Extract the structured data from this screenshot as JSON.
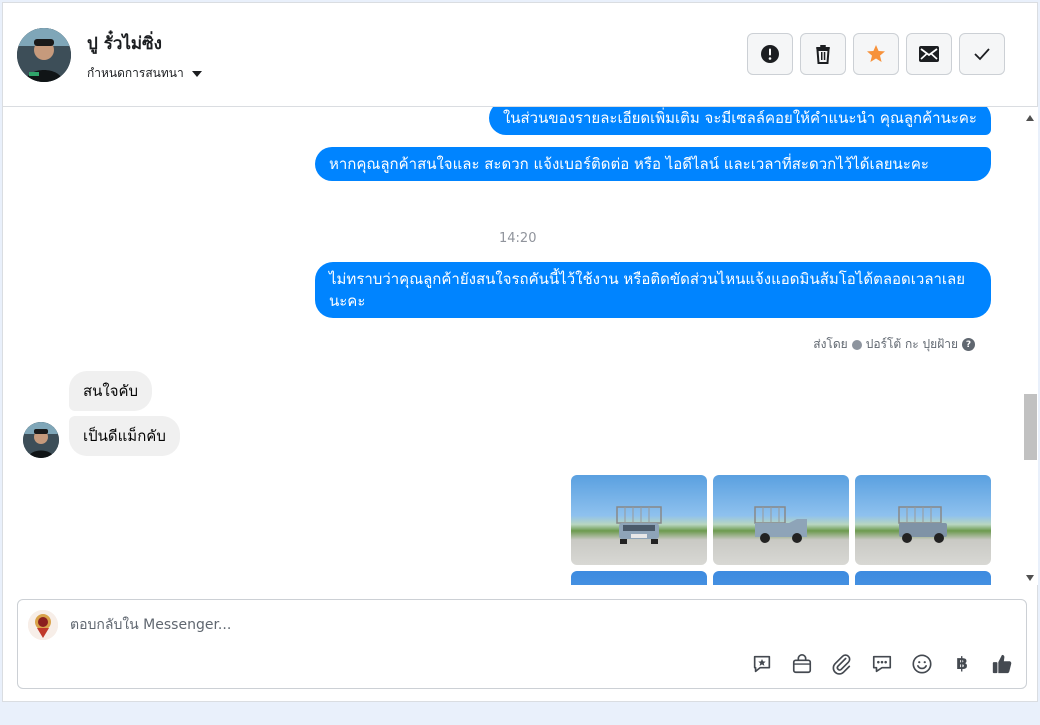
{
  "contact": {
    "name": "ปู รั๋วไม่ซิ่ง",
    "assign_label": "กำหนดการสนทนา"
  },
  "header_actions": [
    {
      "icon": "alert-icon",
      "color": "#1c1e21"
    },
    {
      "icon": "trash-icon",
      "color": "#1c1e21"
    },
    {
      "icon": "star-icon",
      "color": "#f7923b"
    },
    {
      "icon": "envelope-icon",
      "color": "#1c1e21"
    },
    {
      "icon": "check-icon",
      "color": "#1c1e21"
    }
  ],
  "messages": {
    "out1": "ในส่วนของรายละเอียดเพิ่มเติม จะมีเซลล์คอยให้คำแนะนำ คุณลูกค้านะคะ",
    "out2": "หากคุณลูกค้าสนใจและ สะดวก แจ้งเบอร์ติดต่อ หรือ ไอดีไลน์ และเวลาที่สะดวกไว้ได้เลยนะคะ",
    "timestamp": "14:20",
    "out3": "ไม่ทราบว่าคุณลูกค้ายังสนใจรถคันนี้ไว้ใช้งาน หรือติดขัดส่วนไหนแจ้งแอดมินส้มโอได้ตลอดเวลาเลยนะคะ",
    "sent_by_prefix": "ส่งโดย",
    "sent_by_name": "ปอร์โต้ กะ ปุยฝ้าย",
    "in1": "สนใจคับ",
    "in2": "เป็นดีแม็กคับ"
  },
  "composer": {
    "placeholder": "ตอบกลับใน Messenger..."
  },
  "composer_tools": [
    "saved-reply-icon",
    "shop-bag-icon",
    "attach-icon",
    "chat-icon",
    "emoji-icon",
    "baht-icon",
    "like-icon"
  ],
  "colors": {
    "outgoing_bubble": "#0084ff",
    "incoming_bubble": "#f0f0f0",
    "star_accent": "#f7923b"
  }
}
